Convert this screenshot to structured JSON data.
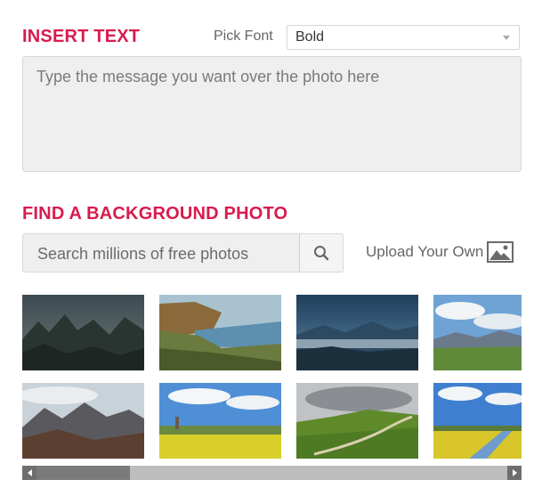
{
  "insert_text": {
    "title": "INSERT TEXT",
    "font_label": "Pick Font",
    "font_value": "Bold",
    "message_placeholder": "Type the message you want over the photo here"
  },
  "background": {
    "title": "FIND A BACKGROUND PHOTO",
    "search_placeholder": "Search millions of free photos",
    "upload_label": "Upload Your Own"
  },
  "icons": {
    "search": "search-icon",
    "upload": "image-icon",
    "select_caret": "chevron-down-icon",
    "scroll_left": "arrow-left-icon",
    "scroll_right": "arrow-right-icon"
  },
  "photos": [
    {
      "subject": "dark misty mountain peaks"
    },
    {
      "subject": "coastal cliffs and cove"
    },
    {
      "subject": "mountains above cloud valley"
    },
    {
      "subject": "green hills under cloudy sky"
    },
    {
      "subject": "highland mountains and moor"
    },
    {
      "subject": "windmill and yellow rapeseed field"
    },
    {
      "subject": "winding path across green hills"
    },
    {
      "subject": "canal through yellow fields"
    }
  ],
  "colors": {
    "accent": "#d81b4f",
    "input_bg": "#efefef",
    "border": "#d8d8d8"
  }
}
